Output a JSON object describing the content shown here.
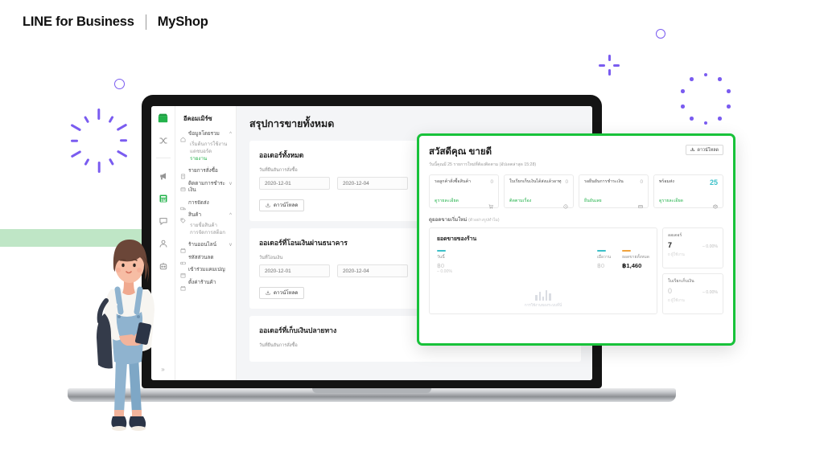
{
  "brand": {
    "name": "LINE for Business",
    "product": "MyShop"
  },
  "rail": {
    "icons": [
      {
        "name": "store-icon",
        "active": true
      },
      {
        "name": "shuffle-icon",
        "active": false
      },
      {
        "name": "megaphone-icon",
        "active": false
      },
      {
        "name": "calculator-icon",
        "active": true
      },
      {
        "name": "chat-icon",
        "active": false
      },
      {
        "name": "person-icon",
        "active": false
      },
      {
        "name": "bot-icon",
        "active": false
      }
    ],
    "expand_label": "»"
  },
  "sidebar": {
    "title": "อีคอมเมิร์ซ",
    "items": [
      {
        "label": "ข้อมูลโดยรวม",
        "icon": "home-icon",
        "chevron": "^",
        "expanded": true
      },
      {
        "label": "รายการสั่งซื้อ",
        "icon": "list-icon",
        "chevron": ""
      },
      {
        "label": "ติดตามการชำระเงิน",
        "icon": "wallet-icon",
        "chevron": "v"
      },
      {
        "label": "การจัดส่ง",
        "icon": "truck-icon",
        "chevron": ""
      },
      {
        "label": "สินค้า",
        "icon": "tag-icon",
        "chevron": "^",
        "expanded": true
      },
      {
        "label": "ร้านออนไลน์",
        "icon": "shop-icon",
        "chevron": "v"
      },
      {
        "label": "รหัสส่วนลด",
        "icon": "coupon-icon",
        "chevron": ""
      },
      {
        "label": "เข้าร่วมแคมเปญ",
        "icon": "campaign-icon",
        "chevron": ""
      },
      {
        "label": "ตั้งค่าร้านค้า",
        "icon": "settings-icon",
        "chevron": ""
      }
    ],
    "sub_overview": [
      {
        "label": "เริ่มต้นการใช้งาน",
        "active": false
      },
      {
        "label": "แดชบอร์ด",
        "active": false
      },
      {
        "label": "รายงาน",
        "active": true
      }
    ],
    "sub_products": [
      {
        "label": "รายชื่อสินค้า",
        "active": false
      },
      {
        "label": "การจัดการสต็อก",
        "active": false
      }
    ]
  },
  "main": {
    "page_title": "สรุปการขายทั้งหมด",
    "cards": [
      {
        "title": "ออเดอร์ทั้งหมด",
        "field_label": "วันที่ยืนยันการสั่งซื้อ",
        "date_from": "2020-12-01",
        "date_to": "2020-12-04",
        "download_label": "ดาวน์โหลด"
      },
      {
        "title": "ออเดอร์ที่โอนเงินผ่านธนาคาร",
        "field_label": "วันที่โอนเงิน",
        "date_from": "2020-12-01",
        "date_to": "2020-12-04",
        "download_label": "ดาวน์โหลด"
      },
      {
        "title": "ออเดอร์ที่เก็บเงินปลายทาง",
        "field_label": "วันที่ยืนยันการสั่งซื้อ",
        "date_from": "",
        "date_to": "",
        "download_label": "ดาวน์โหลด"
      }
    ]
  },
  "popup": {
    "title": "สวัสดีคุณ ขายดี",
    "subtitle": "วันนี้คุณมี 25 รายการใหม่ที่ต้องติดตาม (อัปเดตล่าสุด 15:28)",
    "download_label": "ดาวน์โหลด",
    "tiles": [
      {
        "label": "รอลูกค้าสั่งซื้อสินค้า",
        "value": "0",
        "link": "ดูรายละเอียด",
        "icon": "cart-icon",
        "highlight": false
      },
      {
        "label": "ใบเรียกเก็บเงินได้ส่งแล้วอาทุ",
        "value": "0",
        "link": "ติดตามเรื่อง",
        "icon": "clock-icon",
        "highlight": false
      },
      {
        "label": "รอยืนยันการชำระเงิน",
        "value": "0",
        "link": "ยืนยันเลย",
        "icon": "card-icon",
        "highlight": false
      },
      {
        "label": "พร้อมส่ง",
        "value": "25",
        "link": "ดูรายละเอียด",
        "icon": "box-icon",
        "highlight": true
      }
    ],
    "section2_label": "ดูยอดขายเริ่มใหม่",
    "section2_muted": "(ตัวอย่างรูปทำไม)",
    "chart": {
      "title": "ยอดขายของร้าน",
      "today_label": "วันนี้",
      "today_value": "฿0",
      "today_delta": "– 0.00%",
      "yesterday_label": "เมื่อวาน",
      "yesterday_value": "฿0",
      "total_label": "ยอดขายทั้งหมด",
      "total_value": "฿1,460",
      "empty_caption": "การใช้งานของระบบที่นี่"
    },
    "right_cards": [
      {
        "label": "ออเดอร์",
        "value": "7",
        "delta": "– 0.00%",
        "sub": "0 ผู้ใช้งาน",
        "muted": false
      },
      {
        "label": "ใบเรียกเก็บเงิน",
        "value": "0",
        "delta": "– 0.00%",
        "sub": "0 ผู้ใช้งาน",
        "muted": true
      }
    ]
  },
  "chart_data": {
    "type": "bar",
    "title": "ยอดขายของร้าน",
    "categories": [
      "วันนี้",
      "เมื่อวาน",
      "ยอดขายทั้งหมด"
    ],
    "values": [
      0,
      0,
      1460
    ],
    "ylabel": "฿",
    "xlabel": "",
    "ylim": [
      0,
      1460
    ],
    "grid": false,
    "legend": "none",
    "annotations": [
      "การใช้งานของระบบที่นี่"
    ]
  },
  "colors": {
    "brand_green": "#18c23a",
    "link_green": "#23b24b",
    "teal": "#3bc0c9",
    "purple": "#7a5cf0",
    "band_green": "#bfe6c6"
  }
}
